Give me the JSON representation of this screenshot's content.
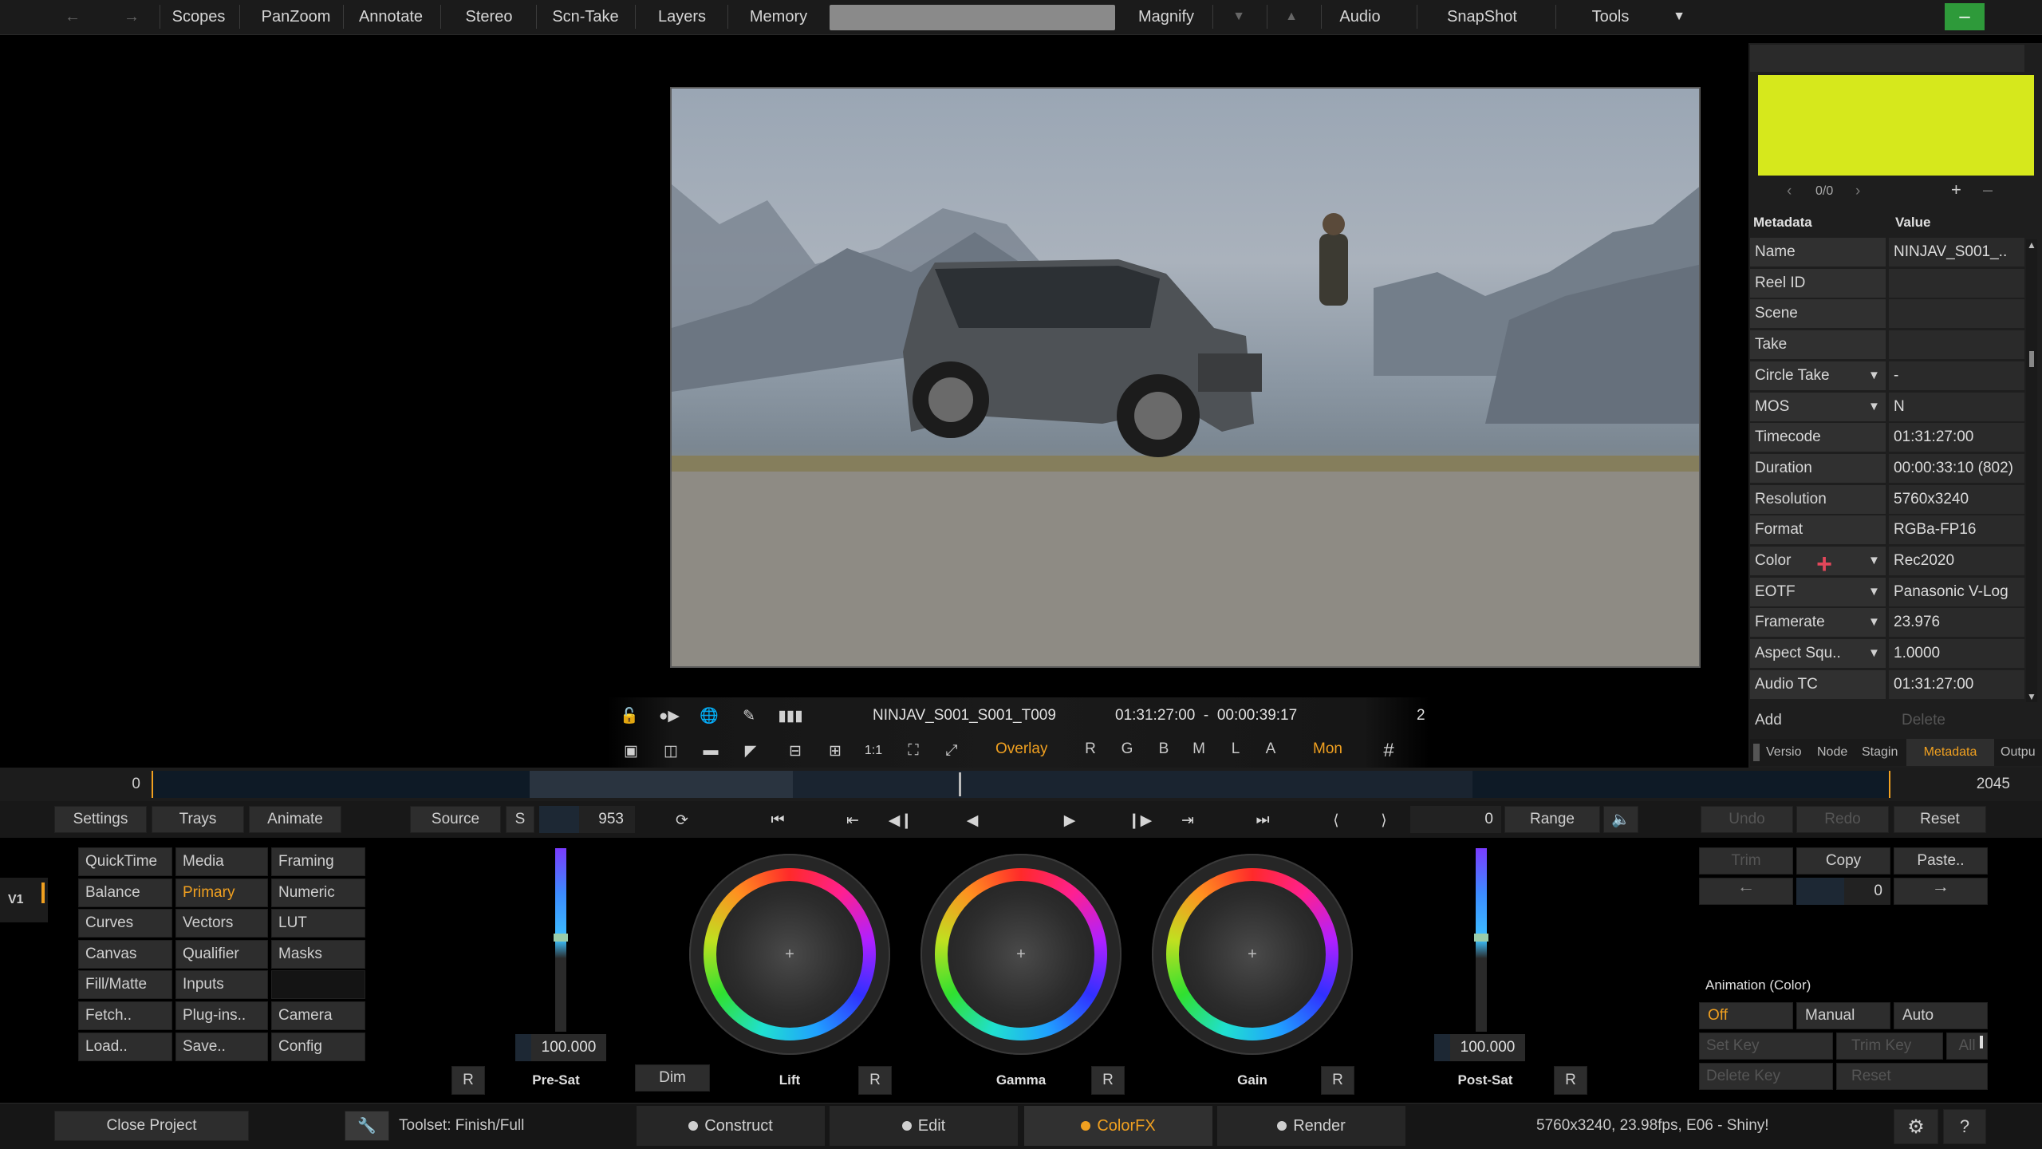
{
  "menu": {
    "items": [
      "Scopes",
      "PanZoom",
      "Annotate",
      "Stereo",
      "Scn-Take",
      "Layers",
      "Memory",
      "Magnify",
      "Audio",
      "SnapShot",
      "Tools"
    ]
  },
  "player": {
    "clip_name": "NINJAV_S001_S001_T009",
    "timecode": "01:31:27:00  -  00:00:39:17",
    "count": "2",
    "overlay_label": "Overlay",
    "channels": [
      "R",
      "G",
      "B",
      "M",
      "L",
      "A"
    ],
    "mon_label": "Mon"
  },
  "timeline": {
    "start": "0",
    "end": "2045"
  },
  "transport": {
    "settings": "Settings",
    "trays": "Trays",
    "animate": "Animate",
    "source": "Source",
    "s": "S",
    "frame": "953",
    "range_value": "0",
    "range": "Range",
    "undo": "Undo",
    "redo": "Redo",
    "reset": "Reset"
  },
  "track": {
    "label": "V1"
  },
  "tools_grid": [
    [
      "QuickTime",
      "Media",
      "Framing"
    ],
    [
      "Balance",
      "Primary",
      "Numeric"
    ],
    [
      "Curves",
      "Vectors",
      "LUT"
    ],
    [
      "Canvas",
      "Qualifier",
      "Masks"
    ],
    [
      "Fill/Matte",
      "Inputs",
      ""
    ],
    [
      "Fetch..",
      "Plug-ins..",
      "Camera"
    ],
    [
      "Load..",
      "Save..",
      "Config"
    ]
  ],
  "primary": {
    "presat_value": "100.000",
    "postsat_value": "100.000",
    "r": "R",
    "dim": "Dim",
    "labels": {
      "presat": "Pre-Sat",
      "lift": "Lift",
      "gamma": "Gamma",
      "gain": "Gain",
      "postsat": "Post-Sat"
    }
  },
  "edit_panel": {
    "trim": "Trim",
    "copy": "Copy",
    "paste": "Paste..",
    "value": "0",
    "animation_title": "Animation (Color)",
    "off": "Off",
    "manual": "Manual",
    "auto": "Auto",
    "set_key": "Set Key",
    "trim_key": "Trim Key",
    "all": "All",
    "delete_key": "Delete Key",
    "reset": "Reset"
  },
  "metadata": {
    "swatch_color": "#d6e81c",
    "counter": "0/0",
    "header_key": "Metadata",
    "header_value": "Value",
    "rows": [
      {
        "k": "Name",
        "v": "NINJAV_S001_..",
        "arrow": false
      },
      {
        "k": "Reel ID",
        "v": "",
        "arrow": false
      },
      {
        "k": "Scene",
        "v": "",
        "arrow": false
      },
      {
        "k": "Take",
        "v": "",
        "arrow": false
      },
      {
        "k": "Circle Take",
        "v": "-",
        "arrow": true
      },
      {
        "k": "MOS",
        "v": "N",
        "arrow": true
      },
      {
        "k": "Timecode",
        "v": "01:31:27:00",
        "arrow": false
      },
      {
        "k": "Duration",
        "v": "00:00:33:10 (802)",
        "arrow": false
      },
      {
        "k": "Resolution",
        "v": "5760x3240",
        "arrow": false
      },
      {
        "k": "Format",
        "v": " RGBa-FP16",
        "arrow": false
      },
      {
        "k": "Color",
        "v": "Rec2020",
        "arrow": true
      },
      {
        "k": "EOTF",
        "v": "Panasonic V-Log",
        "arrow": true
      },
      {
        "k": "Framerate",
        "v": "23.976",
        "arrow": true
      },
      {
        "k": "Aspect Squ..",
        "v": "1.0000",
        "arrow": true
      },
      {
        "k": "Audio TC",
        "v": "01:31:27:00",
        "arrow": false
      }
    ],
    "add": "Add",
    "delete": "Delete",
    "tabs": [
      "Versio",
      "Node",
      "Stagin",
      "Metadata",
      "Outpu"
    ]
  },
  "bottom": {
    "close_project": "Close Project",
    "toolset": "Toolset: Finish/Full",
    "tabs": [
      {
        "label": "Construct",
        "dot": "#cfcfcf"
      },
      {
        "label": "Edit",
        "dot": "#cfcfcf"
      },
      {
        "label": "ColorFX",
        "dot": "#f0a020"
      },
      {
        "label": "Render",
        "dot": "#cfcfcf"
      }
    ],
    "status": "5760x3240, 23.98fps, E06 - Shiny!",
    "help": "?"
  },
  "colors": {
    "accent": "#f0a020",
    "panel": "#2d2d2d",
    "background": "#000000"
  }
}
